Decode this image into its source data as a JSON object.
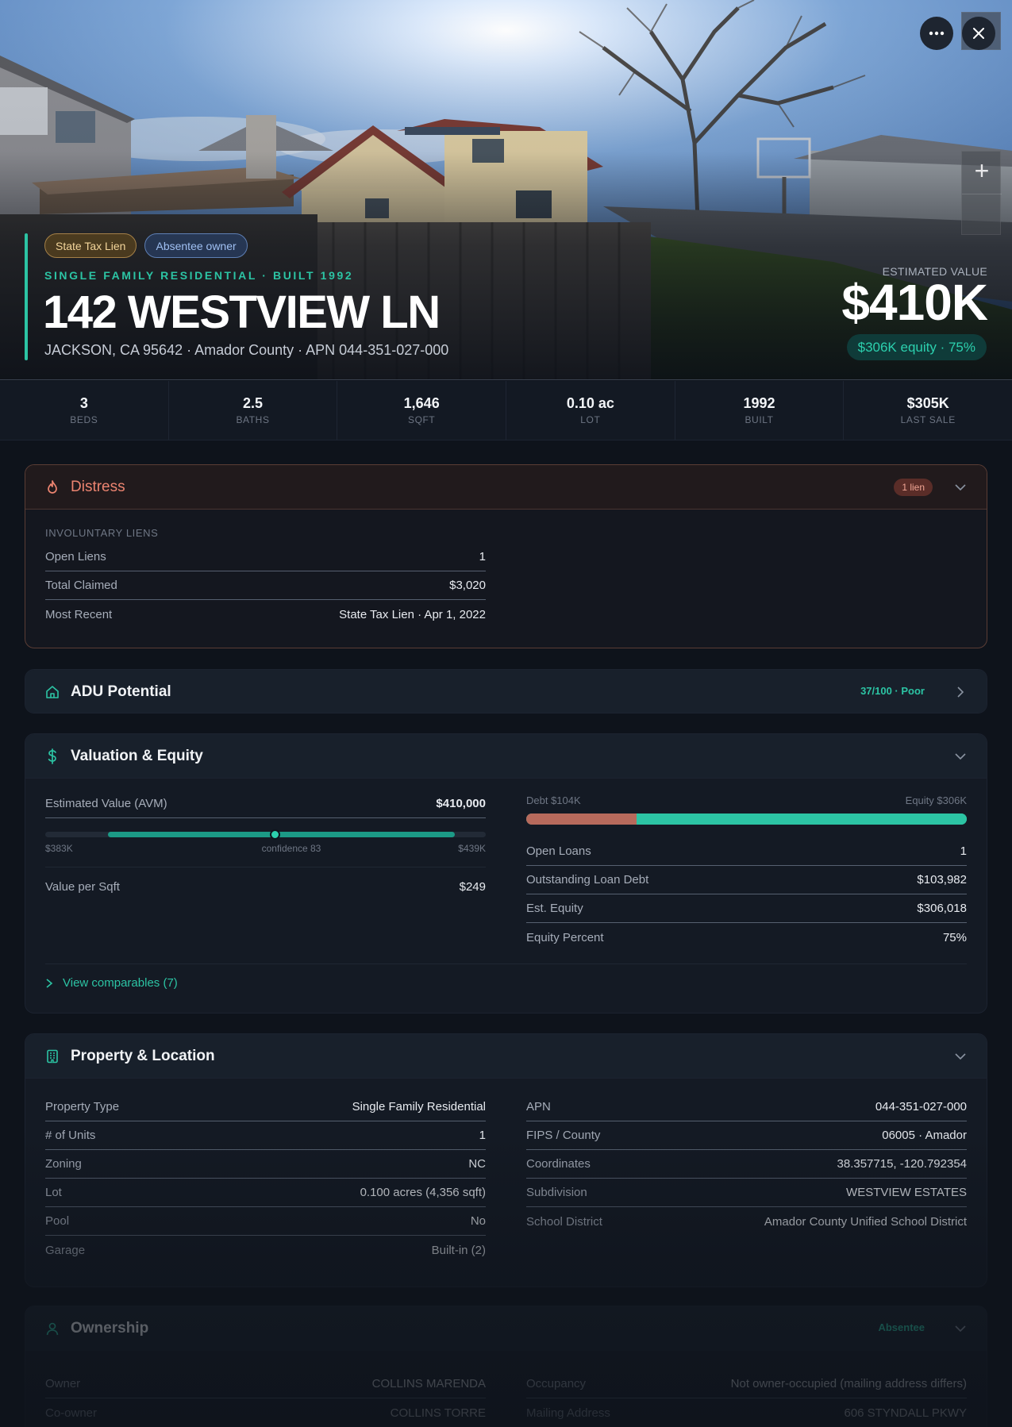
{
  "hero": {
    "tags": [
      "State Tax Lien",
      "Absentee owner"
    ],
    "kicker": "SINGLE FAMILY RESIDENTIAL · BUILT 1992",
    "address": "142 WESTVIEW LN",
    "subaddress": "JACKSON, CA 95642 · Amador County · APN 044-351-027-000",
    "estimated_label": "ESTIMATED VALUE",
    "estimated_value": "$410K",
    "equity_pill": "$306K equity · 75%"
  },
  "stats": [
    {
      "value": "3",
      "label": "BEDS"
    },
    {
      "value": "2.5",
      "label": "BATHS"
    },
    {
      "value": "1,646",
      "label": "SQFT"
    },
    {
      "value": "0.10 ac",
      "label": "LOT"
    },
    {
      "value": "1992",
      "label": "BUILT"
    },
    {
      "value": "$305K",
      "label": "LAST SALE"
    }
  ],
  "distress": {
    "title": "Distress",
    "badge": "1 lien",
    "section_label": "INVOLUNTARY LIENS",
    "rows": [
      {
        "key": "Open Liens",
        "value": "1"
      },
      {
        "key": "Total Claimed",
        "value": "$3,020"
      },
      {
        "key": "Most Recent",
        "value": "State Tax Lien · Apr 1, 2022"
      }
    ]
  },
  "adu": {
    "title": "ADU Potential",
    "score": "37/100 · Poor"
  },
  "valuation": {
    "title": "Valuation & Equity",
    "avm_label": "Estimated Value (AVM)",
    "avm_value": "$410,000",
    "range_low": "$383K",
    "range_high": "$439K",
    "confidence": "confidence 83",
    "avm_low_num": 383,
    "avm_high_num": 439,
    "avm_point_num": 410,
    "value_per_sqft_label": "Value per Sqft",
    "value_per_sqft": "$249",
    "debt_label": "Debt $104K",
    "equity_label": "Equity $306K",
    "debt_fraction": 0.25,
    "rows": [
      {
        "key": "Open Loans",
        "value": "1"
      },
      {
        "key": "Outstanding Loan Debt",
        "value": "$103,982"
      },
      {
        "key": "Est. Equity",
        "value": "$306,018"
      },
      {
        "key": "Equity Percent",
        "value": "75%"
      }
    ],
    "comparables_link": "View comparables (7)"
  },
  "property": {
    "title": "Property & Location",
    "left": [
      {
        "key": "Property Type",
        "value": "Single Family Residential"
      },
      {
        "key": "# of Units",
        "value": "1"
      },
      {
        "key": "Zoning",
        "value": "NC"
      },
      {
        "key": "Lot",
        "value": "0.100 acres (4,356 sqft)"
      },
      {
        "key": "Pool",
        "value": "No"
      },
      {
        "key": "Garage",
        "value": "Built-in (2)"
      }
    ],
    "right": [
      {
        "key": "APN",
        "value": "044-351-027-000"
      },
      {
        "key": "FIPS / County",
        "value": "06005 · Amador"
      },
      {
        "key": "Coordinates",
        "value": "38.357715, -120.792354"
      },
      {
        "key": "Subdivision",
        "value": "WESTVIEW ESTATES"
      },
      {
        "key": "School District",
        "value": "Amador County Unified School District"
      }
    ]
  },
  "ownership": {
    "title": "Ownership",
    "badge": "Absentee",
    "left": [
      {
        "key": "Owner",
        "value": "COLLINS MARENDA"
      },
      {
        "key": "Co-owner",
        "value": "COLLINS TORRE"
      }
    ],
    "right": [
      {
        "key": "Occupancy",
        "value": "Not owner-occupied (mailing address differs)"
      },
      {
        "key": "Mailing Address",
        "value": "606 STYNDALL PKWY"
      }
    ]
  },
  "colors": {
    "accent": "#2cc4a4",
    "distress": "#ec8470",
    "debt": "#b76a5c"
  }
}
